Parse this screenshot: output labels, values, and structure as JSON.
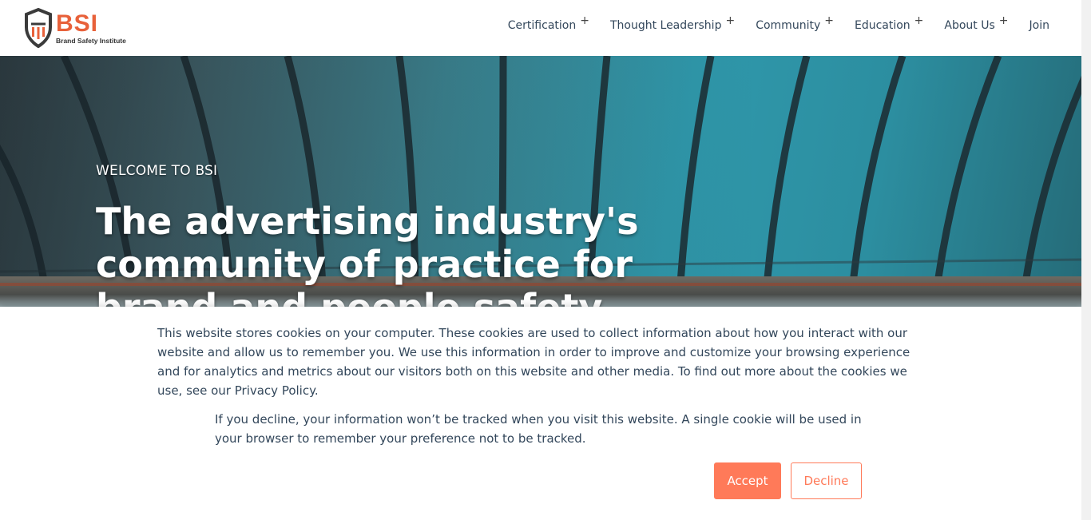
{
  "logo": {
    "name": "BSI",
    "tagline": "Brand Safety Institute"
  },
  "nav": {
    "items": [
      {
        "label": "Certification",
        "expand": "+"
      },
      {
        "label": "Thought Leadership",
        "expand": "+"
      },
      {
        "label": "Community",
        "expand": "+"
      },
      {
        "label": "Education",
        "expand": "+"
      },
      {
        "label": "About Us",
        "expand": "+"
      },
      {
        "label": "Join",
        "expand": ""
      }
    ]
  },
  "hero": {
    "eyebrow": "WELCOME TO BSI",
    "title": "The advertising industry's community of practice for brand and people safety"
  },
  "cookie_banner": {
    "text1_main": "This website stores cookies on your computer. These cookies are used to collect information about how you interact with our website and allow us to remember you. We use this information in order to improve and customize your browsing experience and for analytics and metrics about our visitors both on this website and other media. To find out more about the cookies we use, see our ",
    "privacy_link": "Privacy Policy",
    "text1_end": ".",
    "text2": "If you decline, your information won’t be tracked when you visit this website. A single cookie will be used in your browser to remember your preference not to be tracked.",
    "accept_label": "Accept",
    "decline_label": "Decline"
  },
  "colors": {
    "accent": "#ff7a59",
    "logo_orange": "#e8613a",
    "text": "#33475b"
  }
}
